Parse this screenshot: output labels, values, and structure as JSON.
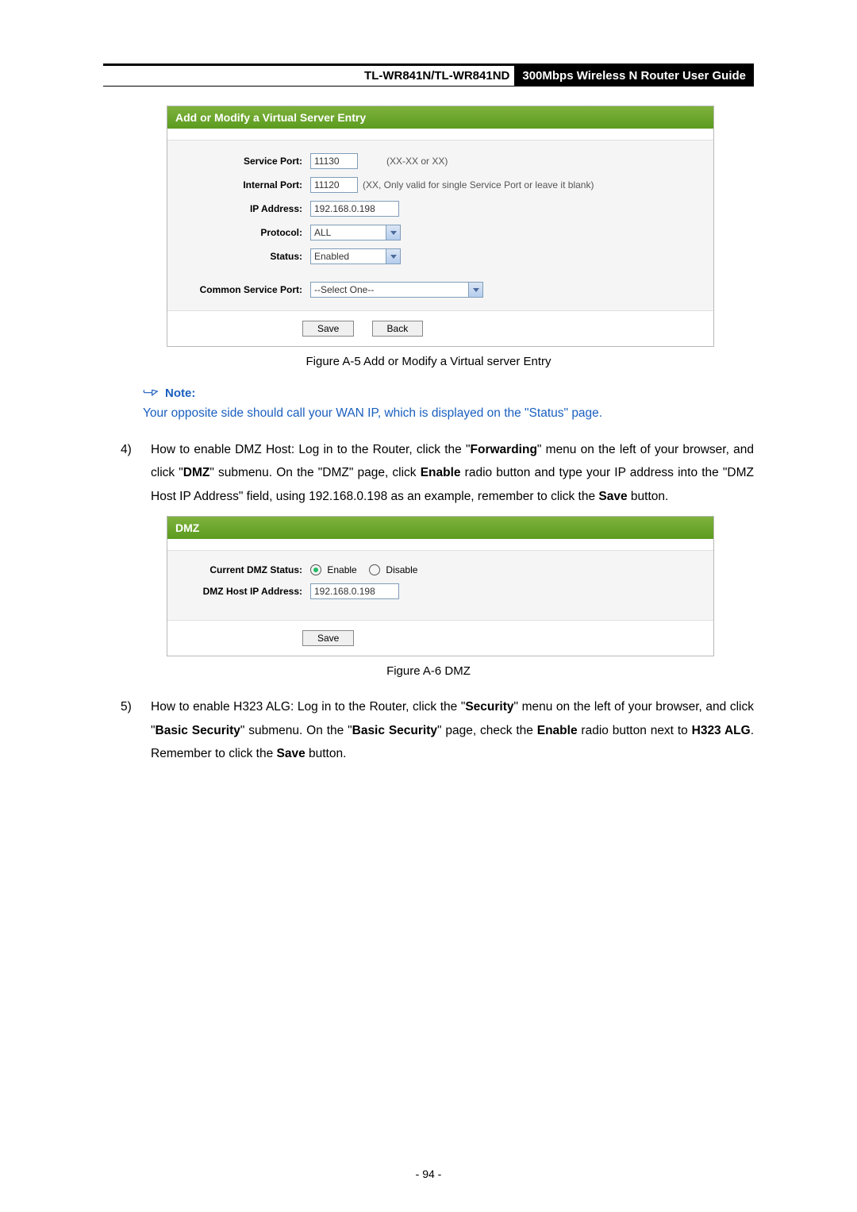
{
  "header": {
    "model": "TL-WR841N/TL-WR841ND",
    "title": "300Mbps Wireless N Router User Guide"
  },
  "panel1": {
    "title": "Add or Modify a Virtual Server Entry",
    "rows": {
      "service_port": {
        "label": "Service Port:",
        "value": "11130",
        "hint": "(XX-XX or XX)"
      },
      "internal_port": {
        "label": "Internal Port:",
        "value": "11120",
        "hint": "(XX, Only valid for single Service Port or leave it blank)"
      },
      "ip_address": {
        "label": "IP Address:",
        "value": "192.168.0.198"
      },
      "protocol": {
        "label": "Protocol:",
        "value": "ALL"
      },
      "status": {
        "label": "Status:",
        "value": "Enabled"
      },
      "common_service": {
        "label": "Common Service Port:",
        "value": "--Select One--"
      }
    },
    "buttons": {
      "save": "Save",
      "back": "Back"
    }
  },
  "caption1": "Figure A-5    Add or Modify a Virtual server Entry",
  "note": {
    "head": "Note:",
    "body": "Your opposite side should call your WAN IP, which is displayed on the \"Status\" page."
  },
  "para4": {
    "num": "4)",
    "t1": "How to enable DMZ Host: Log in to the Router, click the \"",
    "b1": "Forwarding",
    "t2": "\" menu on the left of your browser, and click \"",
    "b2": "DMZ",
    "t3": "\" submenu. On the \"DMZ\" page, click ",
    "b3": "Enable",
    "t4": " radio button and type your IP address into the \"DMZ Host IP Address\" field, using 192.168.0.198 as an example, remember to click the ",
    "b4": "Save",
    "t5": " button."
  },
  "panel2": {
    "title": "DMZ",
    "rows": {
      "status": {
        "label": "Current DMZ Status:",
        "enable": "Enable",
        "disable": "Disable"
      },
      "ip": {
        "label": "DMZ Host IP Address:",
        "value": "192.168.0.198"
      }
    },
    "buttons": {
      "save": "Save"
    }
  },
  "caption2": "Figure A-6 DMZ",
  "para5": {
    "num": "5)",
    "t1": "How to enable H323 ALG: Log in to the Router, click the \"",
    "b1": "Security",
    "t2": "\" menu on the left of your browser, and click \"",
    "b2": "Basic Security",
    "t3": "\" submenu. On the \"",
    "b3": "Basic Security",
    "t4": "\" page, check the ",
    "b4": "Enable",
    "t5": " radio button next to ",
    "b5": "H323 ALG",
    "t6": ". Remember to click the ",
    "b6": "Save",
    "t7": " button."
  },
  "pagenum": "- 94 -"
}
